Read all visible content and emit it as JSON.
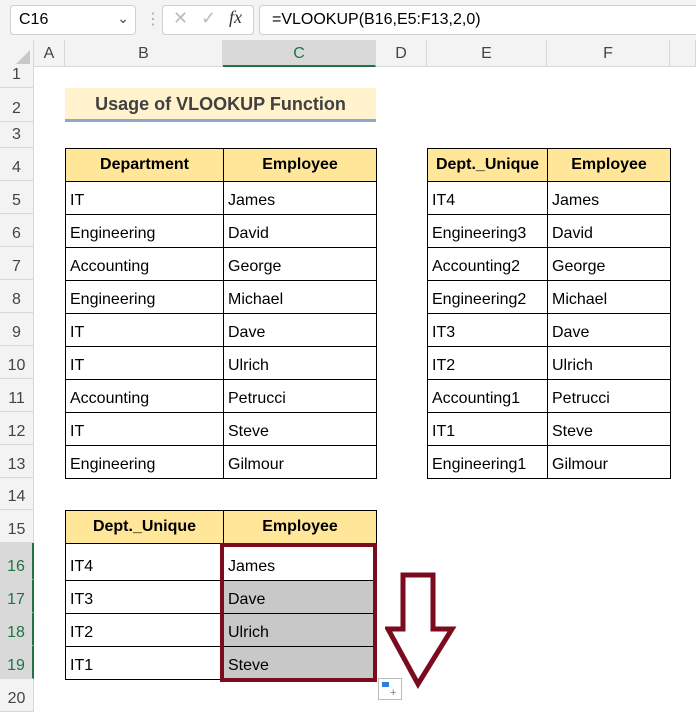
{
  "formula_bar": {
    "name_box": "C16",
    "formula": "=VLOOKUP(B16,E5:F13,2,0)",
    "fx": "fx"
  },
  "columns": [
    "A",
    "B",
    "C",
    "D",
    "E",
    "F"
  ],
  "rows": [
    "1",
    "2",
    "3",
    "4",
    "5",
    "6",
    "7",
    "8",
    "9",
    "10",
    "11",
    "12",
    "13",
    "14",
    "15",
    "16",
    "17",
    "18",
    "19",
    "20"
  ],
  "title": "Usage of VLOOKUP Function",
  "table1": {
    "headers": [
      "Department",
      "Employee"
    ],
    "rows": [
      [
        "IT",
        "James"
      ],
      [
        "Engineering",
        "David"
      ],
      [
        "Accounting",
        "George"
      ],
      [
        "Engineering",
        "Michael"
      ],
      [
        "IT",
        "Dave"
      ],
      [
        "IT",
        "Ulrich"
      ],
      [
        "Accounting",
        "Petrucci"
      ],
      [
        "IT",
        "Steve"
      ],
      [
        "Engineering",
        "Gilmour"
      ]
    ]
  },
  "table2": {
    "headers": [
      "Dept._Unique",
      "Employee"
    ],
    "rows": [
      [
        "IT4",
        "James"
      ],
      [
        "Engineering3",
        "David"
      ],
      [
        "Accounting2",
        "George"
      ],
      [
        "Engineering2",
        "Michael"
      ],
      [
        "IT3",
        "Dave"
      ],
      [
        "IT2",
        "Ulrich"
      ],
      [
        "Accounting1",
        "Petrucci"
      ],
      [
        "IT1",
        "Steve"
      ],
      [
        "Engineering1",
        "Gilmour"
      ]
    ]
  },
  "table3": {
    "headers": [
      "Dept._Unique",
      "Employee"
    ],
    "rows": [
      [
        "IT4",
        "James"
      ],
      [
        "IT3",
        "Dave"
      ],
      [
        "IT2",
        "Ulrich"
      ],
      [
        "IT1",
        "Steve"
      ]
    ]
  },
  "colors": {
    "header_fill": "#FFE699",
    "title_fill": "#FFF2CC",
    "highlight": "#7B0B1E",
    "excel_green": "#217346"
  }
}
